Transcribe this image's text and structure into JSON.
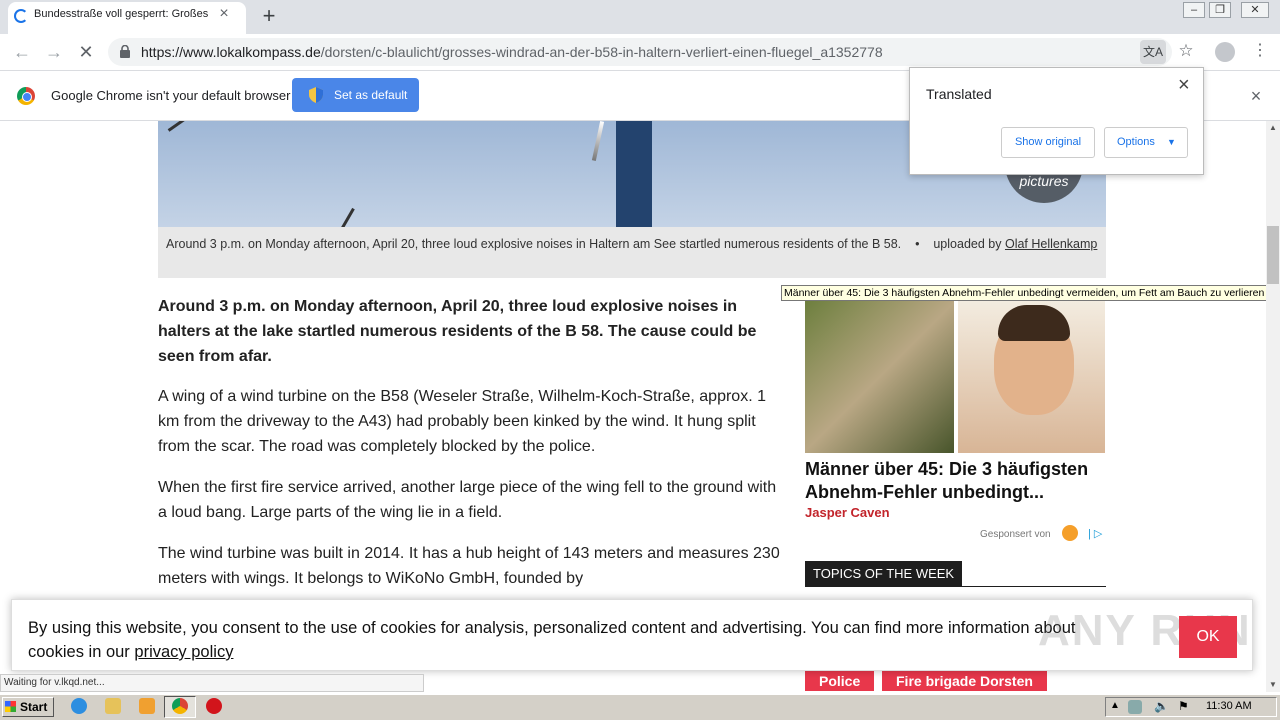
{
  "browser": {
    "tab_title": "Bundesstraße voll gesperrt: Großes",
    "url_host": "https://www.lokalkompass.de",
    "url_path": "/dorsten/c-blaulicht/grosses-windrad-an-der-b58-in-haltern-verliert-einen-fluegel_a1352778",
    "tab_close_glyph": "×",
    "new_tab_glyph": "+"
  },
  "infobar": {
    "message": "Google Chrome isn't your default browser",
    "button_label": "Set as default",
    "close_glyph": "×"
  },
  "translate_popup": {
    "title": "Translated",
    "show_original": "Show original",
    "options": "Options",
    "close_glyph": "×"
  },
  "article": {
    "pictures_badge": "pictures",
    "caption": "Around 3 p.m. on Monday afternoon, April 20, three loud explosive noises in Haltern am See startled numerous residents of the B 58.",
    "caption_sep": "•",
    "uploaded_by": "uploaded by",
    "author": "Olaf Hellenkamp",
    "lead": "Around 3 p.m. on Monday afternoon, April 20, three loud explosive noises in halters at the lake startled numerous residents of the B 58. The cause could be seen from afar.",
    "paragraphs": [
      "A wing of a wind turbine on the B58 (Weseler Straße, Wilhelm-Koch-Straße, approx. 1 km from the driveway to the A43) had probably been kinked by the wind. It hung split from the scar. The road was completely blocked by the police.",
      "When the first fire service arrived, another large piece of the wing fell to the ground with a loud bang. Large parts of the wing lie in a field.",
      "The wind turbine was built in 2014. It has a hub height of 143 meters and measures 230 meters with wings. It belongs to WiKoNo GmbH, founded by"
    ]
  },
  "ad": {
    "tooltip": "Männer über 45: Die 3 häufigsten Abnehm-Fehler unbedingt vermeiden, um Fett am Bauch zu verlieren",
    "headline": "Männer über 45: Die 3 häufigsten Abnehm-Fehler unbedingt...",
    "author": "Jasper Caven",
    "sponsored": "Gesponsert von",
    "sponsor_sep": "|",
    "adchoice_glyph": "▷"
  },
  "topics": {
    "title": "TOPICS OF THE WEEK",
    "tags": [
      "Police",
      "Fire brigade Dorsten"
    ]
  },
  "cookie": {
    "text": "By using this website, you consent to the use of cookies for analysis, personalized content and advertising. You can find more information about cookies in our",
    "link": "privacy policy",
    "ok": "OK"
  },
  "watermark": "ANY RUN",
  "status": "Waiting for v.lkqd.net...",
  "taskbar": {
    "start": "Start",
    "clock": "11:30 AM"
  },
  "colors": {
    "accent": "#4a86e8",
    "tag_red": "#e8374b",
    "ad_author_red": "#c2242b"
  }
}
